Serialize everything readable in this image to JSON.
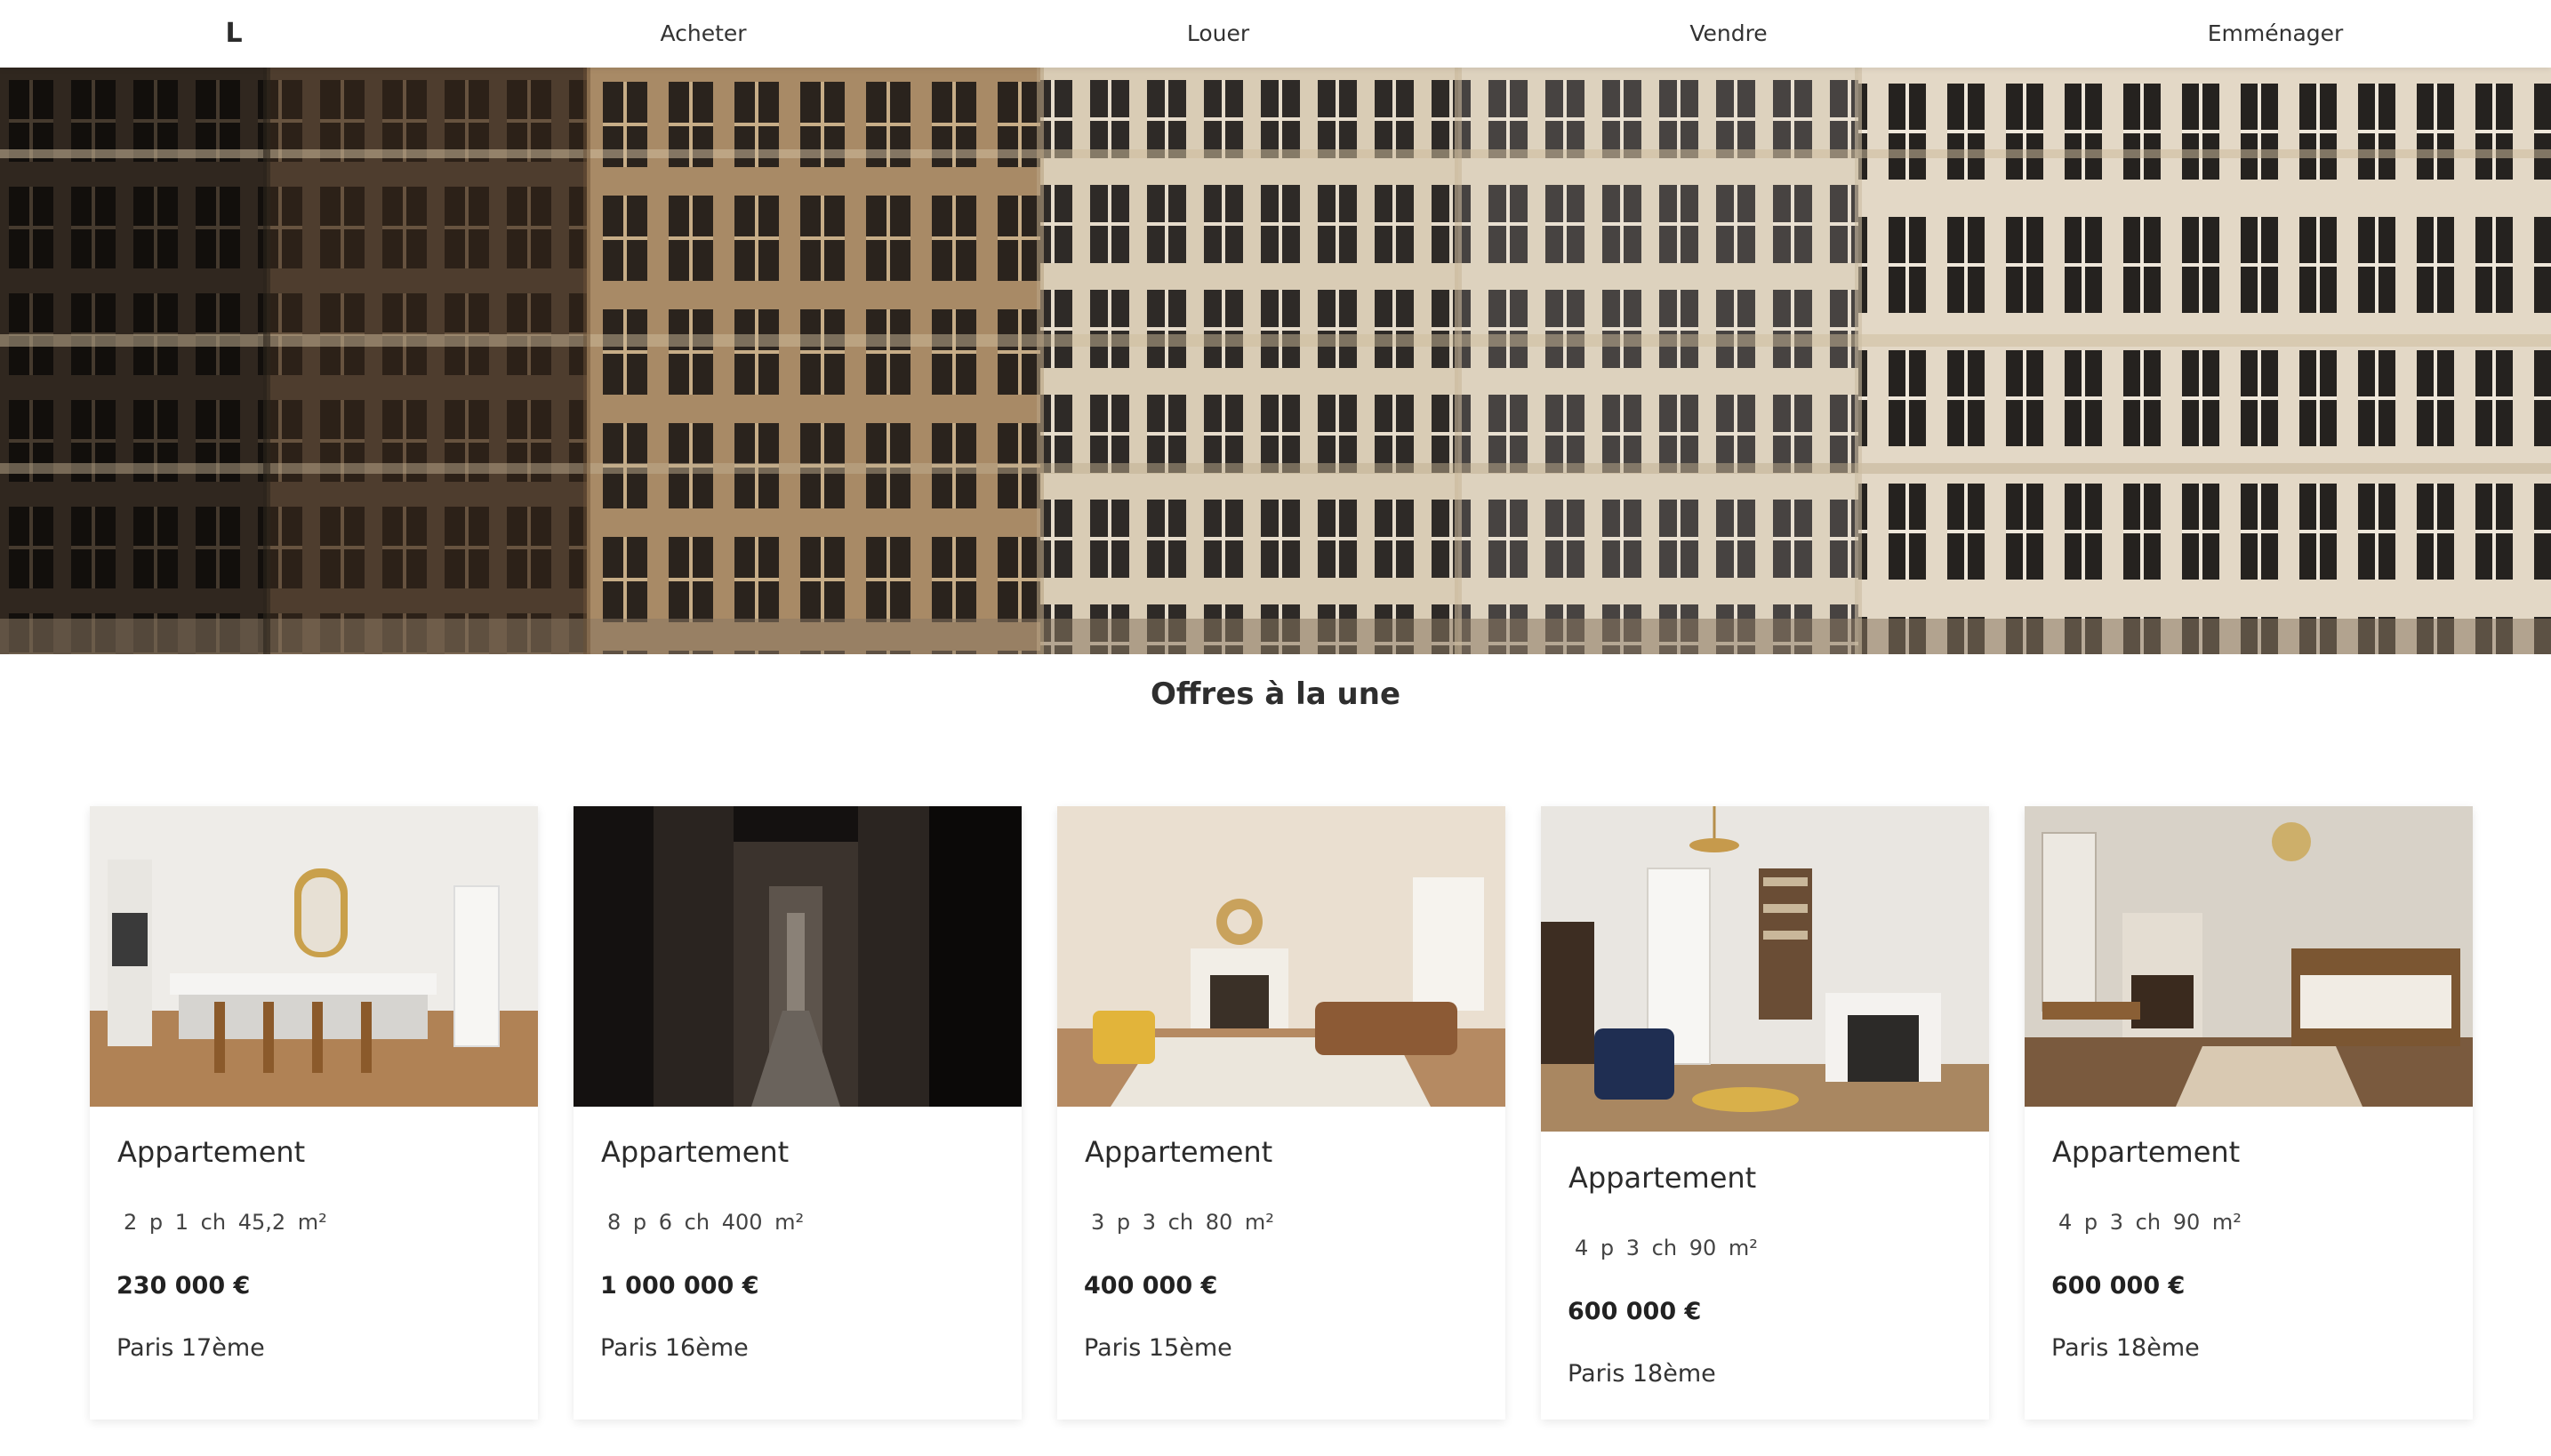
{
  "nav": {
    "logo": "L",
    "links": [
      "Acheter",
      "Louer",
      "Vendre",
      "Emménager"
    ]
  },
  "hero": {
    "image": "facade-buildings-photo"
  },
  "section": {
    "title": "Offres à la une"
  },
  "listings": [
    {
      "type": "Appartement",
      "specs": "2 p  1 ch  45,2 m²",
      "price": "230 000 €",
      "location": "Paris 17ème",
      "image": "kitchen-photo"
    },
    {
      "type": "Appartement",
      "specs": "8 p  6 ch  400 m²",
      "price": "1 000 000 €",
      "location": "Paris 16ème",
      "image": "dark-hallway-photo"
    },
    {
      "type": "Appartement",
      "specs": "3 p  3 ch  80 m²",
      "price": "400 000 €",
      "location": "Paris 15ème",
      "image": "living-room-photo"
    },
    {
      "type": "Appartement",
      "specs": "4 p  3 ch  90 m²",
      "price": "600 000 €",
      "location": "Paris 18ème",
      "image": "fireplace-living-photo"
    },
    {
      "type": "Appartement",
      "specs": "4 p  3 ch  90 m²",
      "price": "600 000 €",
      "location": "Paris 18ème",
      "image": "bedroom-photo"
    }
  ],
  "colors": {
    "text": "#2b2b2b",
    "background": "#ffffff",
    "stone": "#c8b89c"
  }
}
